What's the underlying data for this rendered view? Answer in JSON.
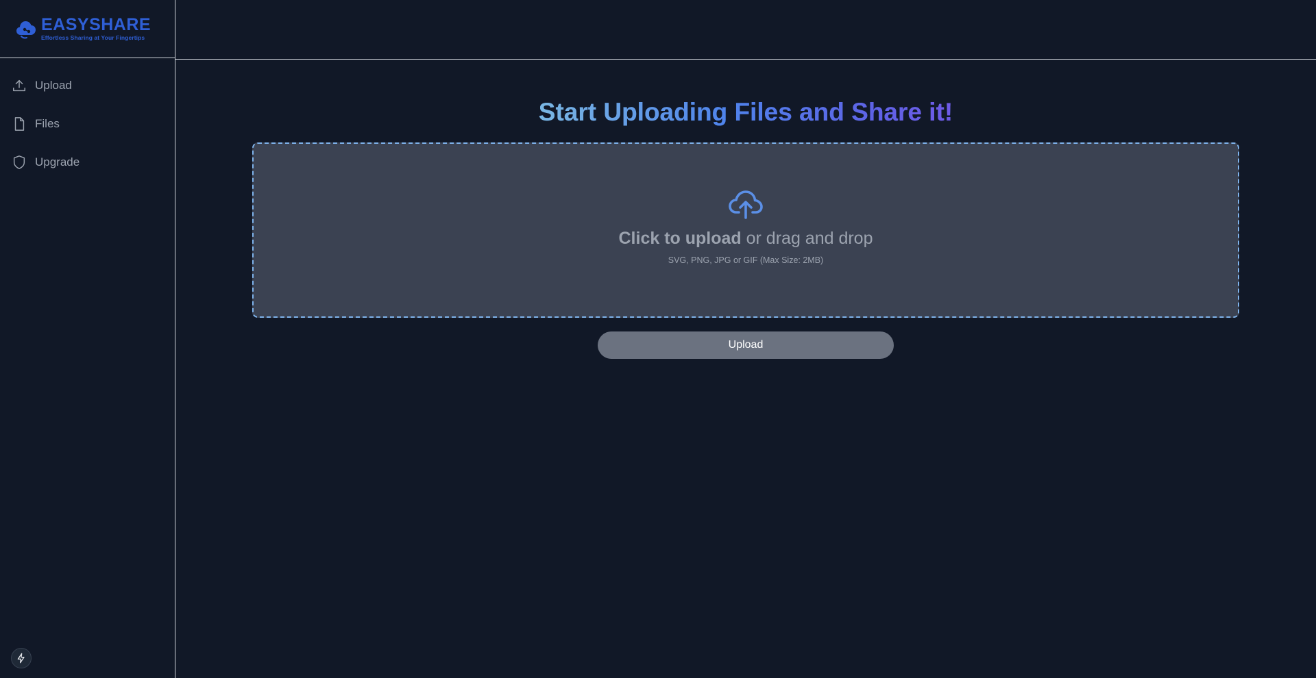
{
  "brand": {
    "name": "EASYSHARE",
    "tagline": "Effortless Sharing at Your Fingertips",
    "color": "#2f5fd6"
  },
  "sidebar": {
    "items": [
      {
        "label": "Upload",
        "icon": "upload-icon"
      },
      {
        "label": "Files",
        "icon": "file-icon"
      },
      {
        "label": "Upgrade",
        "icon": "shield-icon"
      }
    ],
    "footer_icon": "bolt-icon"
  },
  "main": {
    "headline": "Start Uploading Files and Share it!",
    "dropzone": {
      "icon": "cloud-upload-icon",
      "primary_bold": "Click to upload",
      "primary_rest": " or drag and drop",
      "hint": "SVG, PNG, JPG or GIF (Max Size: 2MB)"
    },
    "upload_button": "Upload"
  },
  "colors": {
    "background": "#111827",
    "dropzone_bg": "#3b4252",
    "dropzone_border": "#7fb3ec",
    "button_bg": "#6b7280",
    "headline_gradient": [
      "#7ab7e2",
      "#4f84ec",
      "#6f5ae7"
    ]
  }
}
